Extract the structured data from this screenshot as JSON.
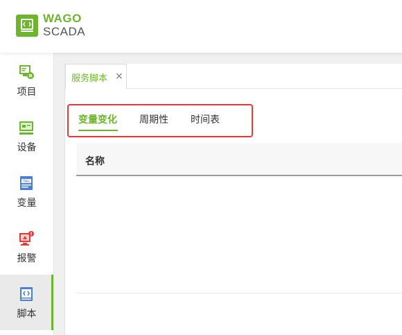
{
  "header": {
    "brand_main": "WAGO",
    "brand_sub": "SCADA",
    "logo_icon": "wago-logo-icon",
    "accent_color": "#6cb52d"
  },
  "sidebar": {
    "items": [
      {
        "label": "项目",
        "icon": "project-icon",
        "active": false
      },
      {
        "label": "设备",
        "icon": "device-icon",
        "active": false
      },
      {
        "label": "变量",
        "icon": "tag-icon",
        "active": false
      },
      {
        "label": "报警",
        "icon": "alarm-icon",
        "active": false
      },
      {
        "label": "脚本",
        "icon": "script-icon",
        "active": true
      }
    ]
  },
  "main": {
    "doc_tab": {
      "label": "服务脚本",
      "close": "×"
    },
    "subtabs": [
      {
        "label": "变量变化",
        "active": true
      },
      {
        "label": "周期性",
        "active": false
      },
      {
        "label": "时间表",
        "active": false
      }
    ],
    "table": {
      "columns": [
        "名称"
      ],
      "rows": []
    }
  }
}
